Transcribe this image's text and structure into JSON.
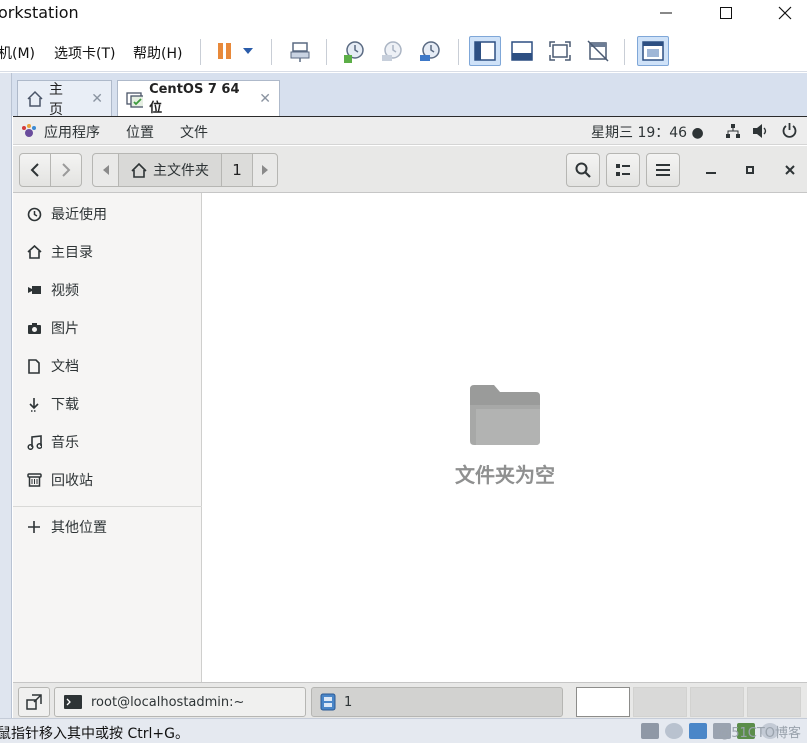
{
  "vmware": {
    "title": "orkstation",
    "menu": [
      "机(M)",
      "选项卡(T)",
      "帮助(H)"
    ],
    "tabs": [
      {
        "label": "主页",
        "active": false
      },
      {
        "label": "CentOS 7 64 位",
        "active": true
      }
    ],
    "status_text": "鼠指针移入其中或按 Ctrl+G。",
    "watermark": "@51CTO博客"
  },
  "gnome": {
    "menu": {
      "apps": "应用程序",
      "places": "位置",
      "files": "文件"
    },
    "clock": "星期三 19：46 ●"
  },
  "nautilus": {
    "path": {
      "home_label": "主文件夹",
      "page": "1"
    },
    "sidebar": [
      {
        "label": "最近使用",
        "icon": "clock-icon"
      },
      {
        "label": "主目录",
        "icon": "home-icon"
      },
      {
        "label": "视频",
        "icon": "video-icon"
      },
      {
        "label": "图片",
        "icon": "camera-icon"
      },
      {
        "label": "文档",
        "icon": "document-icon"
      },
      {
        "label": "下载",
        "icon": "download-icon"
      },
      {
        "label": "音乐",
        "icon": "music-icon"
      },
      {
        "label": "回收站",
        "icon": "trash-icon"
      },
      {
        "label": "其他位置",
        "icon": "plus-icon"
      }
    ],
    "empty_message": "文件夹为空"
  },
  "taskbar": {
    "terminal_label": "root@localhostadmin:~",
    "files_label": "1"
  },
  "colors": {
    "vm_tab_bg": "#d7e0ee",
    "gnome_header": "#e8e8e7",
    "empty_text": "#8f9090",
    "pause_orange": "#e8893a"
  }
}
